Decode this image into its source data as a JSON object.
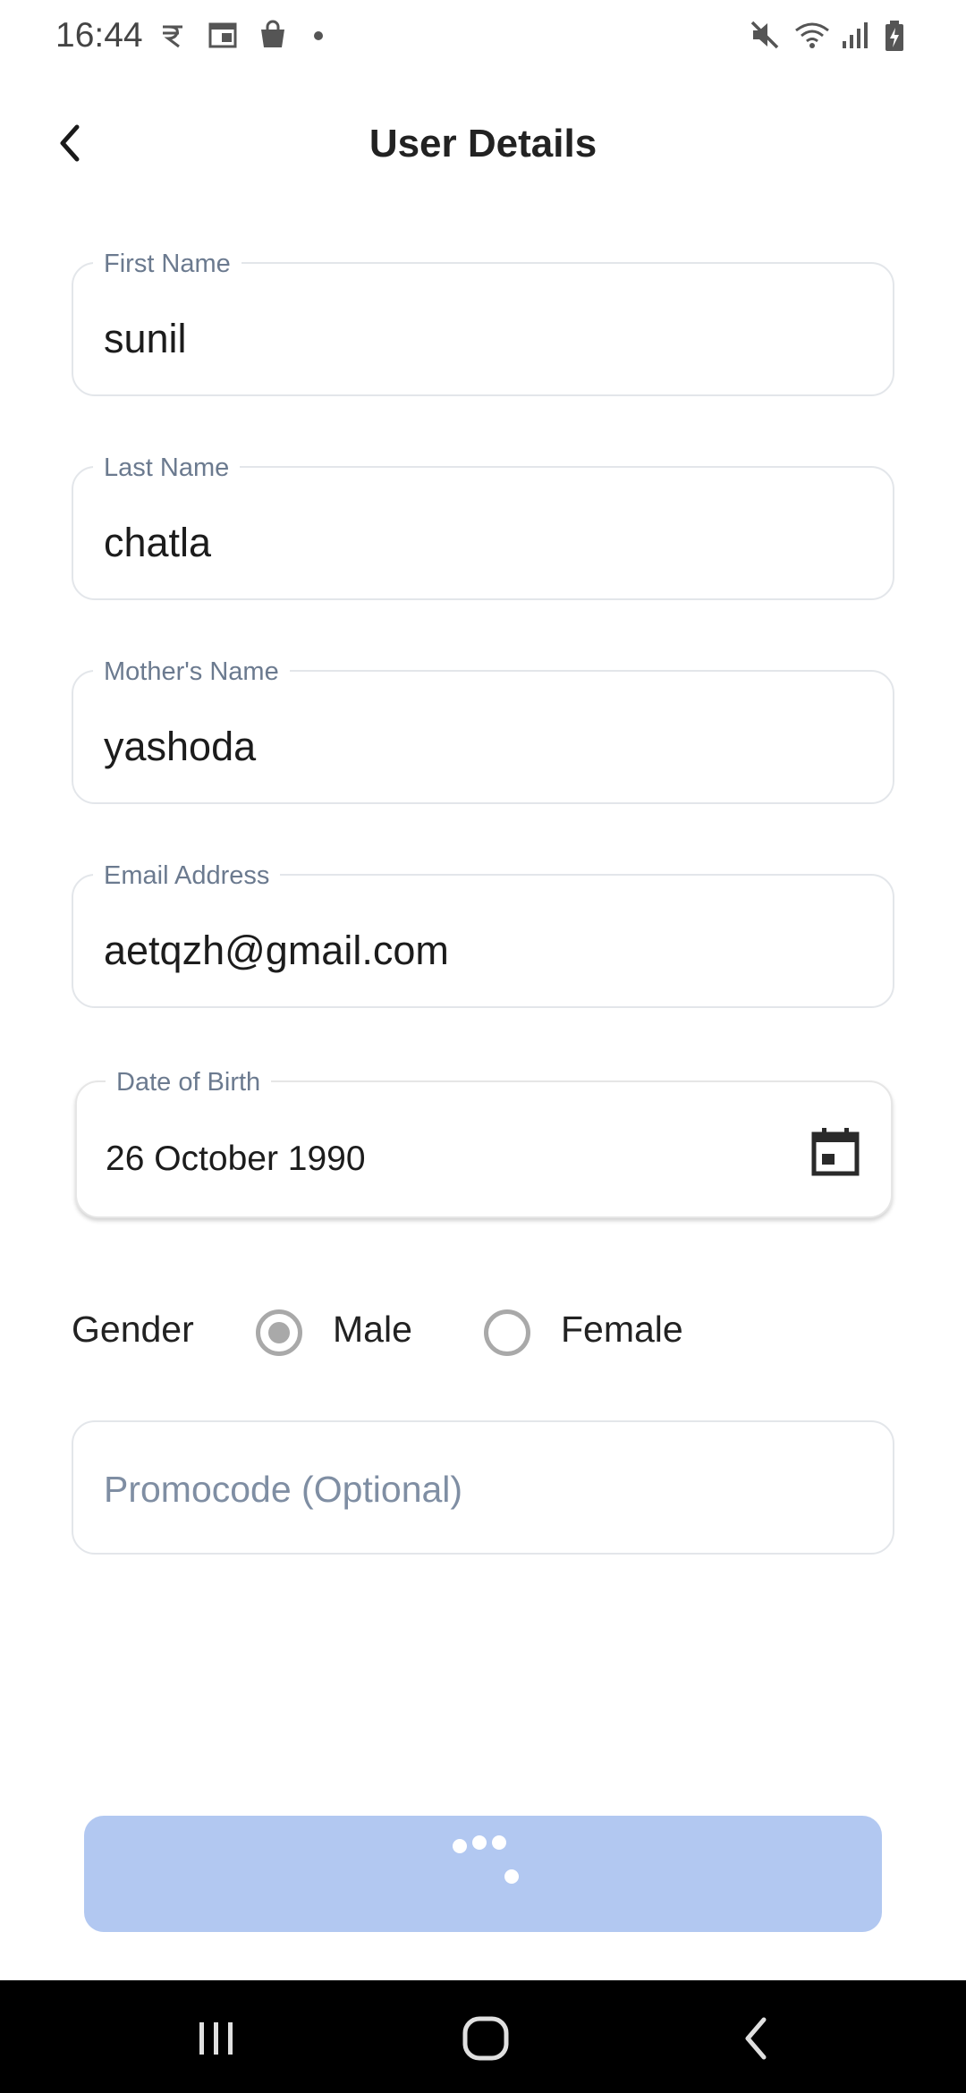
{
  "status_bar": {
    "time": "16:44",
    "left_icons": [
      "rupee-icon",
      "calendar-widget-icon",
      "shopping-bag-icon",
      "dot-icon"
    ],
    "right_icons": [
      "mute-icon",
      "wifi-icon",
      "signal-icon",
      "battery-icon"
    ]
  },
  "header": {
    "title": "User Details",
    "back_icon": "chevron-left-icon"
  },
  "form": {
    "first_name": {
      "label": "First Name",
      "value": "sunil"
    },
    "last_name": {
      "label": "Last Name",
      "value": "chatla"
    },
    "mothers_name": {
      "label": "Mother's Name",
      "value": "yashoda"
    },
    "email": {
      "label": "Email Address",
      "value": "aetqzh@gmail.com"
    },
    "dob": {
      "label": "Date of Birth",
      "value": "26 October 1990",
      "icon": "calendar-icon"
    },
    "gender": {
      "label": "Gender",
      "options": [
        {
          "label": "Male",
          "selected": true
        },
        {
          "label": "Female",
          "selected": false
        }
      ]
    },
    "promocode": {
      "placeholder": "Promocode (Optional)",
      "value": ""
    }
  },
  "submit": {
    "state": "loading",
    "color": "#b2c8f1"
  },
  "nav_bar": {
    "buttons": [
      "recent-apps-icon",
      "home-icon",
      "back-icon"
    ]
  },
  "colors": {
    "label": "#6b7a8f",
    "border": "#e3e6ea",
    "radio": "#a9a9a9",
    "button": "#b2c8f1"
  }
}
